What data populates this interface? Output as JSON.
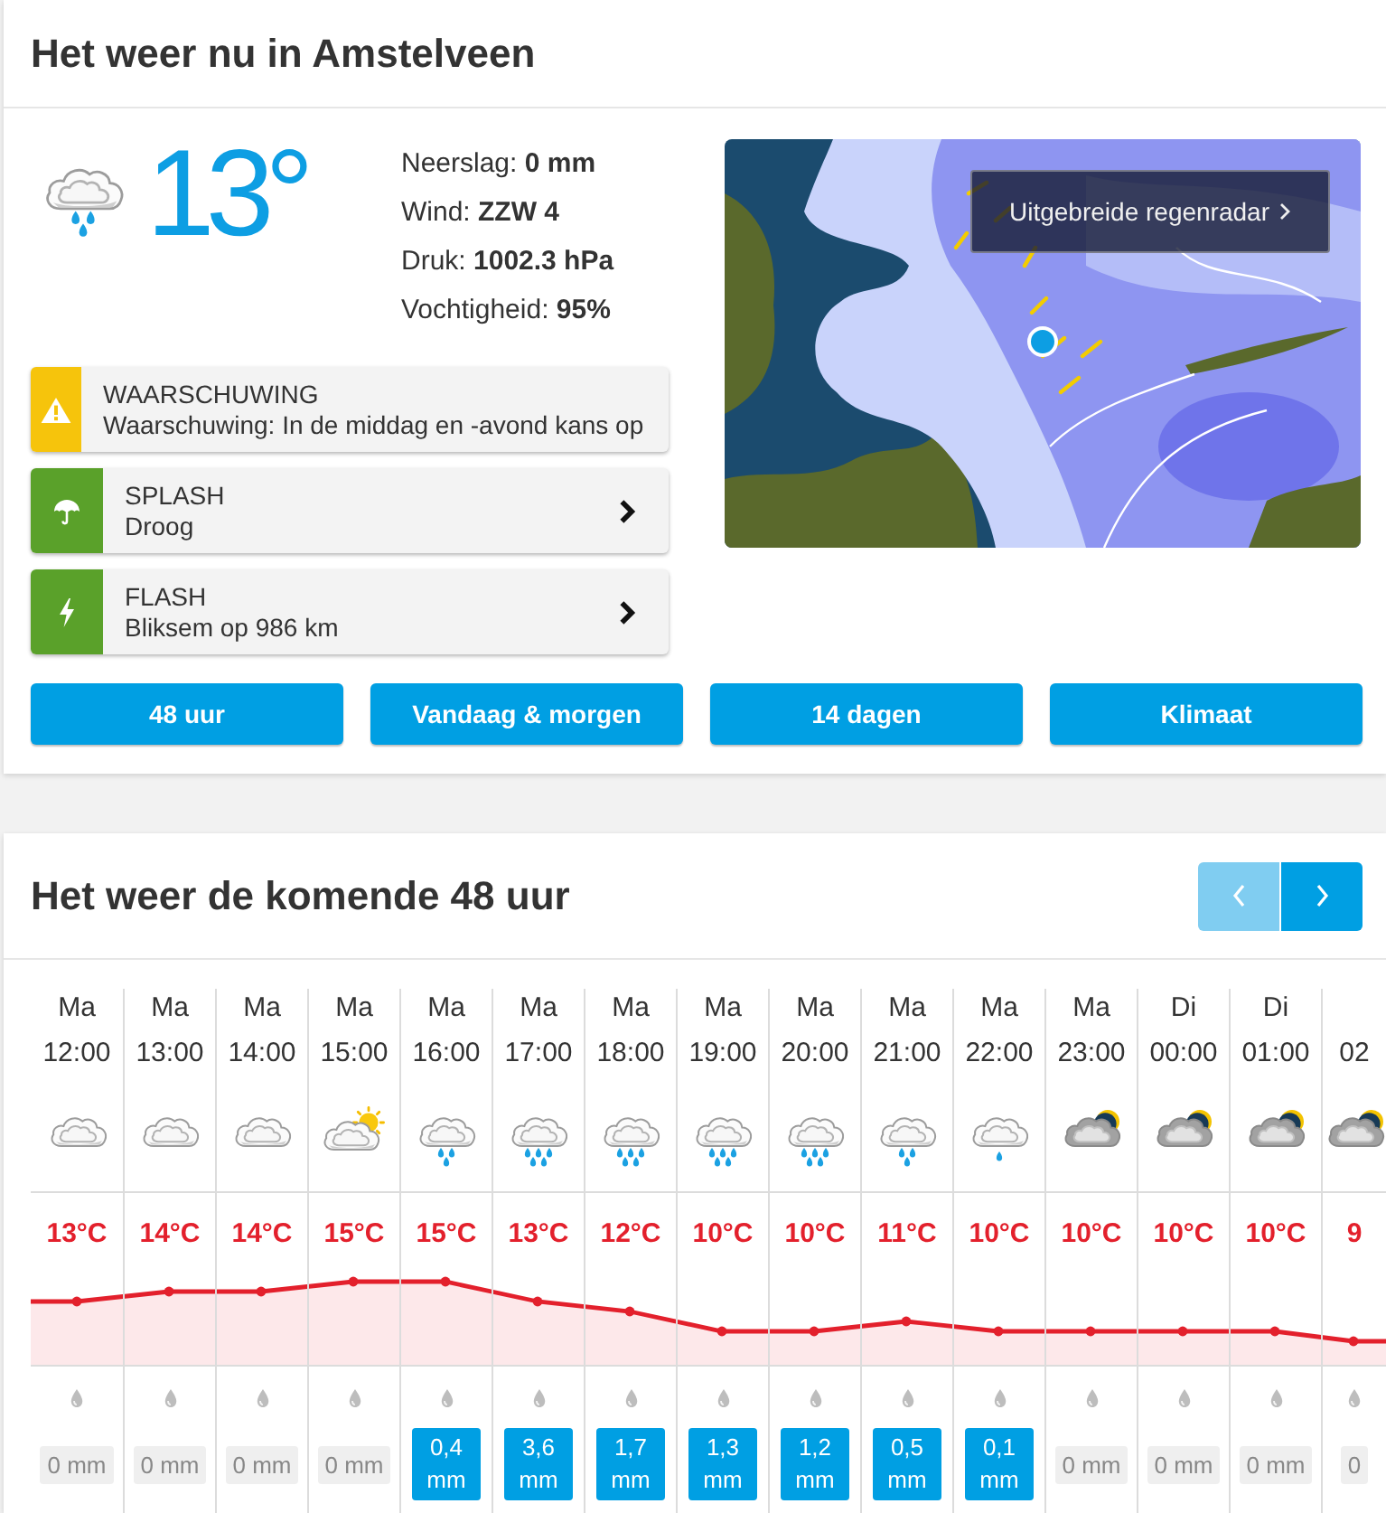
{
  "current": {
    "title": "Het weer nu in Amstelveen",
    "kind": "rain",
    "temperature": "13°",
    "details": [
      "Neerslag: **0 mm**",
      "Wind: **ZZW 4**",
      "Druk: **1002.3 hPa**",
      "Vochtigheid: **95%**"
    ],
    "alerts": [
      {
        "kind": "warning",
        "color": "#f6c40c",
        "title": "WAARSCHUWING",
        "text": "Waarschuwing: In de middag en -avond kans op"
      },
      {
        "kind": "umbrella",
        "color": "#5aa12a",
        "title": "SPLASH",
        "text": "Droog"
      },
      {
        "kind": "lightning",
        "color": "#5aa12a",
        "title": "FLASH",
        "text": "Bliksem op 986 km"
      }
    ],
    "radar": {
      "link": "Uitgebreide regenradar"
    },
    "buttons": [
      "48 uur",
      "Vandaag & morgen",
      "14 dagen",
      "Klimaat"
    ]
  },
  "forecast": {
    "title": "Het weer de komende 48 uur",
    "nav": [
      {
        "kind": "prev",
        "disabled": true
      },
      {
        "kind": "next",
        "disabled": false
      }
    ],
    "hours": [
      {
        "day": "Ma",
        "time": "12:00",
        "kind": "cloudy",
        "temp": "13°C",
        "rain": "0 mm",
        "wet": false
      },
      {
        "day": "Ma",
        "time": "13:00",
        "kind": "cloudy",
        "temp": "14°C",
        "rain": "0 mm",
        "wet": false
      },
      {
        "day": "Ma",
        "time": "14:00",
        "kind": "cloudy",
        "temp": "14°C",
        "rain": "0 mm",
        "wet": false
      },
      {
        "day": "Ma",
        "time": "15:00",
        "kind": "sunny",
        "temp": "15°C",
        "rain": "0 mm",
        "wet": false
      },
      {
        "day": "Ma",
        "time": "16:00",
        "kind": "rain",
        "temp": "15°C",
        "rain": "0,4 mm",
        "wet": true
      },
      {
        "day": "Ma",
        "time": "17:00",
        "kind": "showers",
        "temp": "13°C",
        "rain": "3,6 mm",
        "wet": true
      },
      {
        "day": "Ma",
        "time": "18:00",
        "kind": "showers",
        "temp": "12°C",
        "rain": "1,7 mm",
        "wet": true
      },
      {
        "day": "Ma",
        "time": "19:00",
        "kind": "showers",
        "temp": "10°C",
        "rain": "1,3 mm",
        "wet": true
      },
      {
        "day": "Ma",
        "time": "20:00",
        "kind": "showers",
        "temp": "10°C",
        "rain": "1,2 mm",
        "wet": true
      },
      {
        "day": "Ma",
        "time": "21:00",
        "kind": "rain",
        "temp": "11°C",
        "rain": "0,5 mm",
        "wet": true
      },
      {
        "day": "Ma",
        "time": "22:00",
        "kind": "drizzle",
        "temp": "10°C",
        "rain": "0,1 mm",
        "wet": true
      },
      {
        "day": "Ma",
        "time": "23:00",
        "kind": "night",
        "temp": "10°C",
        "rain": "0 mm",
        "wet": false
      },
      {
        "day": "Di",
        "time": "00:00",
        "kind": "night",
        "temp": "10°C",
        "rain": "0 mm",
        "wet": false
      },
      {
        "day": "Di",
        "time": "01:00",
        "kind": "night",
        "temp": "10°C",
        "rain": "0 mm",
        "wet": false
      },
      {
        "time": "02",
        "kind": "night",
        "temp": "9",
        "rain": "0",
        "wet": false
      }
    ]
  }
}
